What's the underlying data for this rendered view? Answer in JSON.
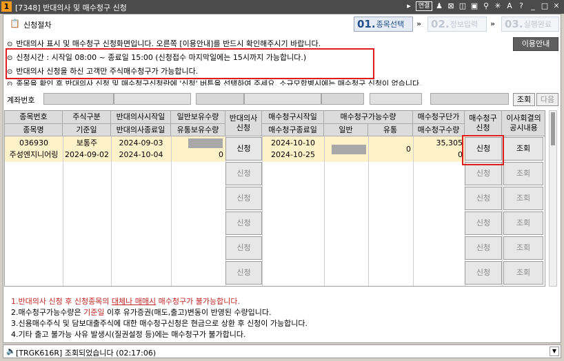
{
  "window": {
    "number": "1",
    "title": "[7348] 반대의사 및 매수청구 신청",
    "link_label": "연결",
    "icons": [
      "play-icon",
      "link-icon",
      "pin-icon",
      "restore-icon",
      "chart-icon",
      "document-icon",
      "tool-icon",
      "star-icon",
      "font-icon",
      "help-icon",
      "minimize-icon",
      "maximize-icon",
      "close-icon"
    ]
  },
  "header": {
    "section_title": "신청절차",
    "steps": [
      {
        "num": "01.",
        "label": "종목선택"
      },
      {
        "num": "02.",
        "label": "정보입력"
      },
      {
        "num": "03.",
        "label": "실행완료"
      }
    ],
    "arrow": "»"
  },
  "notices": [
    "반대의사 표시 및 매수청구 신청화면입니다. 오른쪽 [이용안내]를 반드시 확인해주시기 바랍니다.",
    "신청시간 : 시작일 08:00 ~ 종료일 15:00 (신청접수 마지막일에는 15시까지 가능합니다.)",
    "반대의사 신청을 하신 고객만 주식매수청구가 가능합니다.",
    "종목을 확인 후 반대의사 신청 및 매수청구신청란에 '신청' 버튼을 선택하여 주세요. 소규모합병시에는 매수청구 신청이 없습니다."
  ],
  "bullet": "⊙",
  "guide_button": "이용안내",
  "account": {
    "label": "계좌번호",
    "query_button": "조회",
    "next_button": "다음"
  },
  "grid": {
    "headers": {
      "code": "종목번호",
      "name": "종목명",
      "stock_type": "주식구분",
      "base_date": "기준일",
      "dissent_start": "반대의사시작일",
      "dissent_end": "반대의사종료일",
      "general_qty": "일반보유수량",
      "float_qty": "유통보유수량",
      "dissent": "반대의사",
      "dissent2": "신청",
      "purchase_start": "매수청구시작일",
      "purchase_end": "매수청구종료일",
      "avail_qty": "매수청구가능수량",
      "avail_general": "일반",
      "avail_float": "유통",
      "price": "매수청구단가",
      "price_qty": "매수청구수량",
      "purchase_apply": "매수청구",
      "purchase_apply2": "신청",
      "board": "이사회결의",
      "board2": "공시내용"
    },
    "rows": [
      {
        "code": "036930",
        "name": "주성엔지니어링",
        "stock_type": "보통주",
        "base_date": "2024-09-02",
        "dissent_start": "2024-09-03",
        "dissent_end": "2024-10-04",
        "float_qty": "0",
        "dissent_btn": "신청",
        "purchase_start": "2024-10-10",
        "purchase_end": "2024-10-25",
        "avail_float": "0",
        "price": "35,305",
        "price_qty": "0",
        "purchase_btn": "신청",
        "board_btn": "조회"
      }
    ],
    "empty_row_buttons": {
      "apply": "신청",
      "view": "조회"
    }
  },
  "notes": {
    "n1_a": "1.반대의사 신청 후 신청종목의 ",
    "n1_b": "대체나 매매시",
    "n1_c": " 매수청구가 불가능합니다.",
    "n2_a": "2.매수청구가능수량은 ",
    "n2_b": "기준일",
    "n2_c": " 이후 유가증권(매도,출고)변동이 반영된 수량입니다.",
    "n3": "3.신용매수주식 및 담보대출주식에 대한 매수청구신청은 현금으로 상환 후 신청이 가능합니다.",
    "n4": "4.기타 출고 불가능 사유 발생시(질권설정 등)에는 매수청구가 불가합니다."
  },
  "status": {
    "message": "[TRGK616R] 조회되었습니다 (02:17:06)"
  },
  "colors": {
    "title_bar": "#4b4b4b",
    "highlight": "#e01b1b",
    "selected_row": "#fdf2c9",
    "note_red": "#c22424",
    "step_active": "#1f4e89"
  }
}
